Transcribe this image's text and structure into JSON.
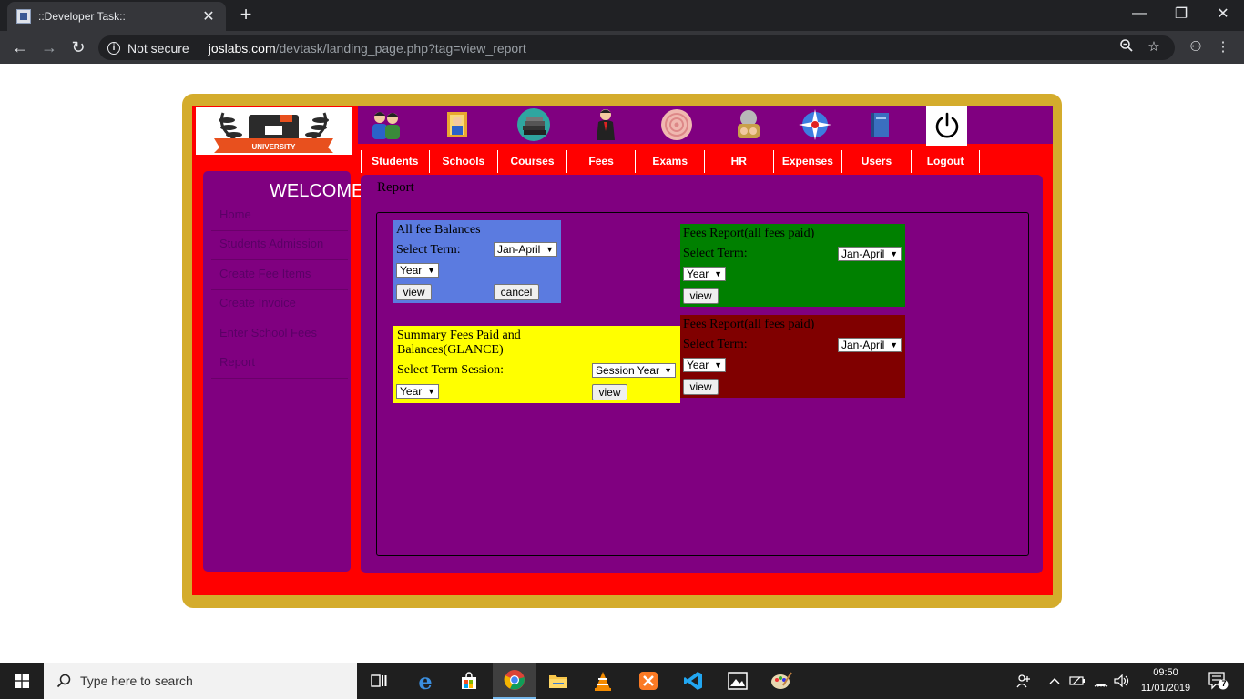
{
  "browser": {
    "tab_title": "::Developer Task::",
    "tab_close": "✕",
    "new_tab": "+",
    "security_label": "Not secure",
    "url_host": "joslabs.com",
    "url_path": "/devtask/landing_page.php?tag=view_report",
    "window_minimize": "—",
    "window_restore": "❐",
    "window_close": "✕"
  },
  "menu": [
    "Students",
    "Schools",
    "Courses",
    "Fees",
    "Exams",
    "HR",
    "Expenses",
    "Users",
    "Logout"
  ],
  "sidebar": {
    "welcome": "WELCOME",
    "items": [
      "Home",
      "Students Admission",
      "Create Fee Items",
      "Create Invoice",
      "Enter School Fees",
      "Report"
    ]
  },
  "main": {
    "title": "Report"
  },
  "panels": {
    "all_fee_balances": {
      "title": "All fee Balances",
      "term_label": "Select Term:",
      "term_value": "Jan-April",
      "year_value": "Year",
      "view_label": "view",
      "cancel_label": "cancel"
    },
    "fees_report_green": {
      "title": "Fees Report(all fees paid)",
      "term_label": "Select Term:",
      "term_value": "Jan-April",
      "year_value": "Year",
      "view_label": "view"
    },
    "summary": {
      "title_line1": "Summary Fees Paid and",
      "title_line2": "Balances(GLANCE)",
      "session_label": "Select Term Session:",
      "session_value": "Session Year",
      "year_value": "Year",
      "view_label": "view"
    },
    "fees_report_maroon": {
      "title": "Fees Report(all fees paid)",
      "term_label": "Select Term:",
      "term_value": "Jan-April",
      "year_value": "Year",
      "view_label": "view"
    }
  },
  "taskbar": {
    "search_placeholder": "Type here to search",
    "time": "09:50",
    "date": "11/01/2019",
    "notifications": "7"
  },
  "colors": {
    "frame_gold": "#d4ac2c",
    "frame_red": "#ff0000",
    "purple": "#800080",
    "panel_blue": "#5b7be0",
    "panel_green": "#008000",
    "panel_yellow": "#ffff00",
    "panel_maroon": "#800000"
  }
}
